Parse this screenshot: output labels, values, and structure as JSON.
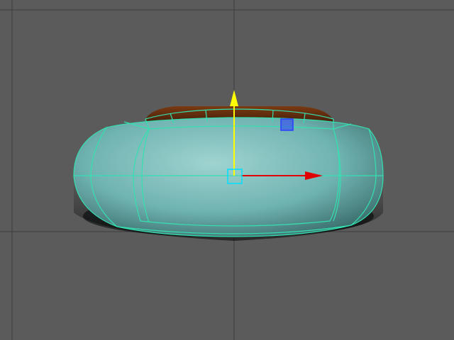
{
  "viewport": {
    "background_color": "#5b5b5b",
    "grid_line_color": "#3a3a3a",
    "view": "front-orthographic"
  },
  "scene": {
    "object_type": "torus-like polygon mesh",
    "mesh_color": "#6fb3b1",
    "mesh_shadow_color": "#1a2a2a",
    "wireframe_color": "#35e0b0",
    "inner_rim_color": "#5a2a10"
  },
  "manipulator": {
    "tool": "move-tool",
    "y_axis_color": "#ffff00",
    "x_axis_color": "#e00000",
    "z_axis_color": "#2a3cff",
    "center_handle_color": "#00e0ff"
  }
}
